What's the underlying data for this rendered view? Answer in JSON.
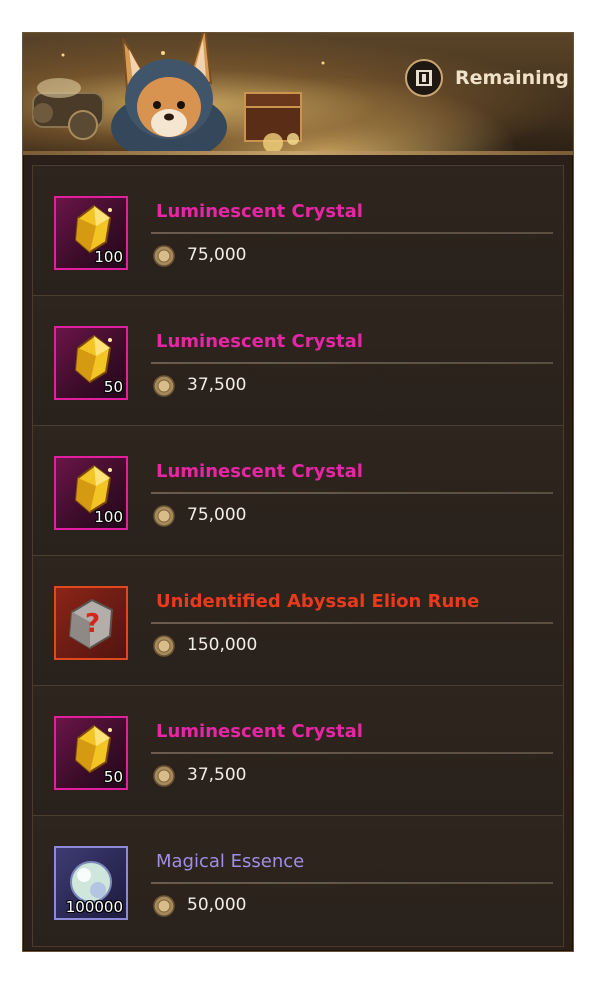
{
  "header": {
    "remaining_label": "Remaining",
    "remaining_icon": "bracket-box-icon"
  },
  "items": [
    {
      "name": "Luminescent Crystal",
      "quantity": "100",
      "price": "75,000",
      "rarity_color": "#e626a4",
      "icon": "crystal-icon"
    },
    {
      "name": "Luminescent Crystal",
      "quantity": "50",
      "price": "37,500",
      "rarity_color": "#e626a4",
      "icon": "crystal-icon"
    },
    {
      "name": "Luminescent Crystal",
      "quantity": "100",
      "price": "75,000",
      "rarity_color": "#e626a4",
      "icon": "crystal-icon"
    },
    {
      "name": "Unidentified Abyssal Elion Rune",
      "quantity": "",
      "price": "150,000",
      "rarity_color": "#ea3a1e",
      "icon": "mystery-rune-icon"
    },
    {
      "name": "Luminescent Crystal",
      "quantity": "50",
      "price": "37,500",
      "rarity_color": "#e626a4",
      "icon": "crystal-icon"
    },
    {
      "name": "Magical Essence",
      "quantity": "100000",
      "price": "50,000",
      "rarity_color": "#9f8fe6",
      "icon": "essence-orb-icon"
    }
  ],
  "currency_icon": "coin-icon"
}
